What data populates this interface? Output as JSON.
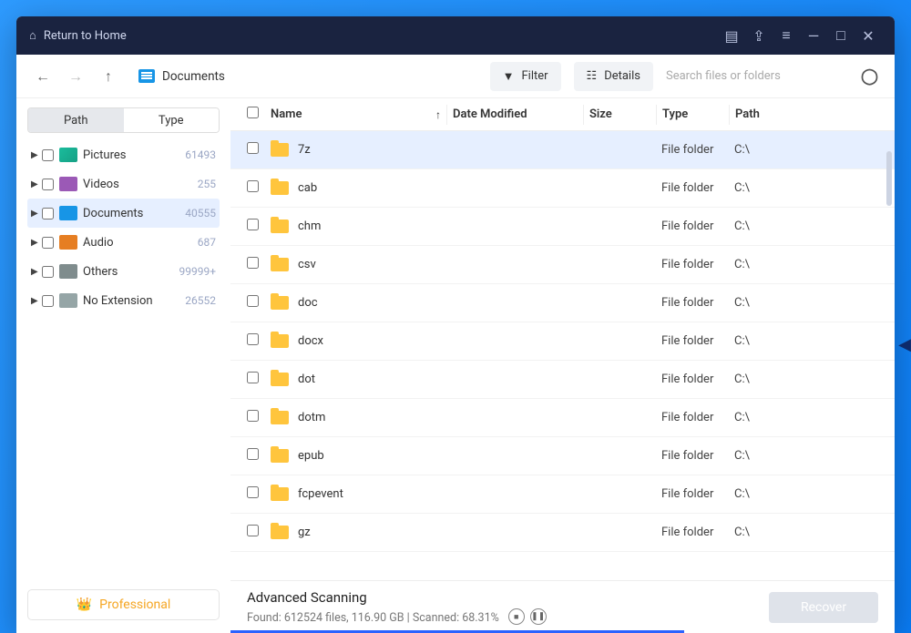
{
  "titlebar": {
    "home_label": "Return to Home"
  },
  "toolbar": {
    "breadcrumb": "Documents",
    "filter_label": "Filter",
    "details_label": "Details",
    "search_placeholder": "Search files or folders"
  },
  "sidebar": {
    "tab_path": "Path",
    "tab_type": "Type",
    "items": [
      {
        "label": "Pictures",
        "count": "61493",
        "icon": "pic-i",
        "selected": false
      },
      {
        "label": "Videos",
        "count": "255",
        "icon": "vid-i",
        "selected": false
      },
      {
        "label": "Documents",
        "count": "40555",
        "icon": "doc-i",
        "selected": true
      },
      {
        "label": "Audio",
        "count": "687",
        "icon": "aud-i",
        "selected": false
      },
      {
        "label": "Others",
        "count": "99999+",
        "icon": "oth-i",
        "selected": false
      },
      {
        "label": "No Extension",
        "count": "26552",
        "icon": "noe-i",
        "selected": false
      }
    ],
    "pro_label": "Professional"
  },
  "columns": {
    "name": "Name",
    "date": "Date Modified",
    "size": "Size",
    "type": "Type",
    "path": "Path"
  },
  "rows": [
    {
      "name": "7z",
      "type": "File folder",
      "path": "C:\\",
      "selected": true
    },
    {
      "name": "cab",
      "type": "File folder",
      "path": "C:\\",
      "selected": false
    },
    {
      "name": "chm",
      "type": "File folder",
      "path": "C:\\",
      "selected": false
    },
    {
      "name": "csv",
      "type": "File folder",
      "path": "C:\\",
      "selected": false
    },
    {
      "name": "doc",
      "type": "File folder",
      "path": "C:\\",
      "selected": false
    },
    {
      "name": "docx",
      "type": "File folder",
      "path": "C:\\",
      "selected": false
    },
    {
      "name": "dot",
      "type": "File folder",
      "path": "C:\\",
      "selected": false
    },
    {
      "name": "dotm",
      "type": "File folder",
      "path": "C:\\",
      "selected": false
    },
    {
      "name": "epub",
      "type": "File folder",
      "path": "C:\\",
      "selected": false
    },
    {
      "name": "fcpevent",
      "type": "File folder",
      "path": "C:\\",
      "selected": false
    },
    {
      "name": "gz",
      "type": "File folder",
      "path": "C:\\",
      "selected": false
    }
  ],
  "footer": {
    "title": "Advanced Scanning",
    "status": "Found: 612524 files, 116.90 GB  |  Scanned: 68.31%",
    "recover_label": "Recover",
    "progress_pct": 68.31
  }
}
